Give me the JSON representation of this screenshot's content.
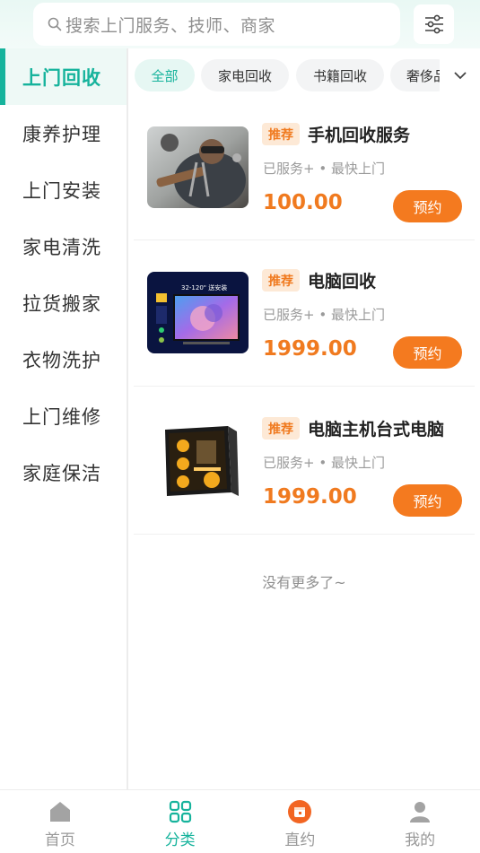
{
  "search": {
    "placeholder": "搜索上门服务、技师、商家"
  },
  "icons": {
    "search": "search-icon",
    "filter": "sliders-icon",
    "dropdown": "chevron-down-icon"
  },
  "colors": {
    "accent": "#16b39c",
    "price": "#f07a1f",
    "button": "#f47a1f"
  },
  "sidebar": {
    "items": [
      {
        "label": "上门回收"
      },
      {
        "label": "康养护理"
      },
      {
        "label": "上门安装"
      },
      {
        "label": "家电清洗"
      },
      {
        "label": "拉货搬家"
      },
      {
        "label": "衣物洗护"
      },
      {
        "label": "上门维修"
      },
      {
        "label": "家庭保洁"
      }
    ],
    "active": "上门回收"
  },
  "subtabs": [
    {
      "label": "全部"
    },
    {
      "label": "家电回收"
    },
    {
      "label": "书籍回收"
    },
    {
      "label": "奢侈品"
    }
  ],
  "products": [
    {
      "badge": "推荐",
      "name": "手机回收服务",
      "meta": "已服务+ • 最快上门",
      "price": "100.00",
      "button": "预约"
    },
    {
      "badge": "推荐",
      "name": "电脑回收",
      "meta": "已服务+ • 最快上门",
      "price": "1999.00",
      "button": "预约"
    },
    {
      "badge": "推荐",
      "name": "电脑主机台式电脑",
      "meta": "已服务+ • 最快上门",
      "price": "1999.00",
      "button": "预约"
    }
  ],
  "tv_screen": {
    "text": "32-120\" 送安装"
  },
  "footer_note": "没有更多了~",
  "tabbar": [
    {
      "label": "首页",
      "icon": "home-icon"
    },
    {
      "label": "分类",
      "icon": "grid-icon"
    },
    {
      "label": "直约",
      "icon": "calendar-icon"
    },
    {
      "label": "我的",
      "icon": "user-icon"
    }
  ]
}
